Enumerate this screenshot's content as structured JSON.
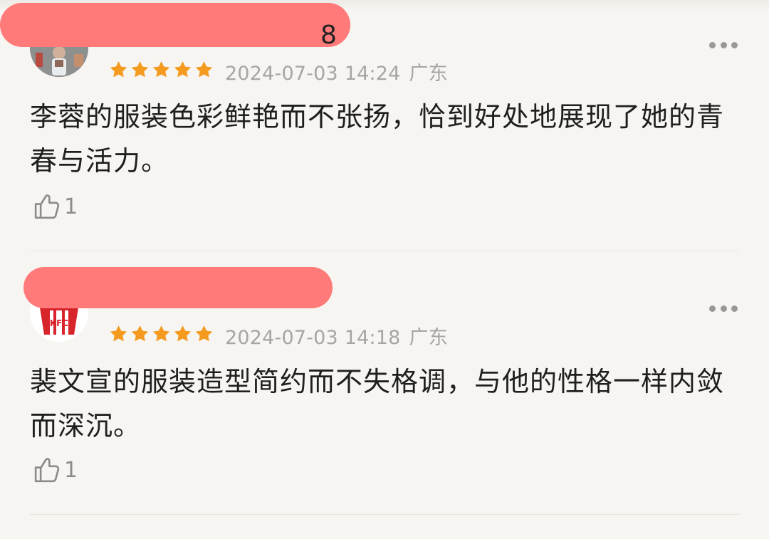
{
  "comments": [
    {
      "name_visible": "8",
      "rating": 5,
      "date": "2024-07-03 14:24",
      "location": "广东",
      "text": "李蓉的服装色彩鲜艳而不张扬，恰到好处地展现了她的青春与活力。",
      "likes": "1",
      "more_icon": "more-icon"
    },
    {
      "name_visible": "",
      "rating": 5,
      "date": "2024-07-03 14:18",
      "location": "广东",
      "text": "裴文宣的服装造型简约而不失格调，与他的性格一样内敛而深沉。",
      "likes": "1",
      "more_icon": "more-icon"
    }
  ],
  "colors": {
    "star": "#f39a1f",
    "redaction": "#ff7a78",
    "meta": "#a7a4a1",
    "background": "#f7f5f2"
  }
}
